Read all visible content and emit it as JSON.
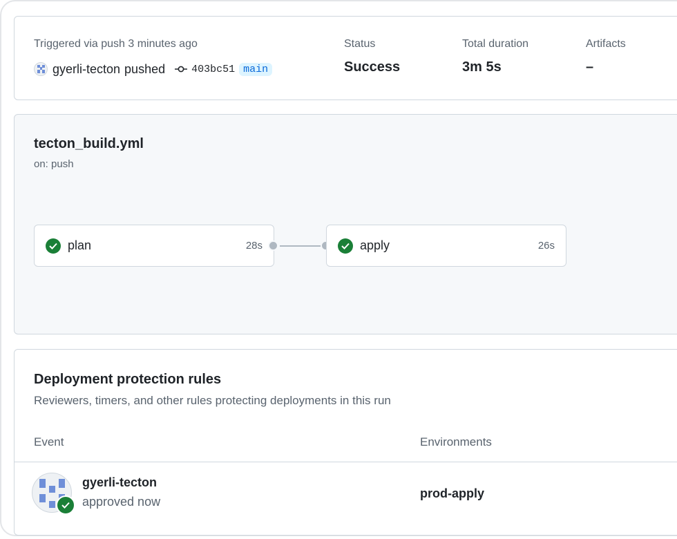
{
  "summary": {
    "trigger_text": "Triggered via push 3 minutes ago",
    "actor": "gyerli-tecton",
    "action": "pushed",
    "commit_sha": "403bc51",
    "branch": "main",
    "status_label": "Status",
    "status_value": "Success",
    "duration_label": "Total duration",
    "duration_value": "3m 5s",
    "artifacts_label": "Artifacts",
    "artifacts_value": "–"
  },
  "workflow": {
    "file": "tecton_build.yml",
    "trigger": "on: push",
    "jobs": [
      {
        "name": "plan",
        "duration": "28s",
        "status": "success"
      },
      {
        "name": "apply",
        "duration": "26s",
        "status": "success"
      }
    ]
  },
  "rules": {
    "title": "Deployment protection rules",
    "description": "Reviewers, timers, and other rules protecting deployments in this run",
    "columns": {
      "event": "Event",
      "environments": "Environments"
    },
    "rows": [
      {
        "reviewer": "gyerli-tecton",
        "state": "approved now",
        "environment": "prod-apply"
      }
    ]
  },
  "colors": {
    "success": "#1a7f37",
    "branch_text": "#0969da",
    "branch_bg": "#ddf4ff",
    "muted": "#59636e",
    "border": "#d0d7de",
    "panel_bg": "#f6f8fa"
  },
  "icons": [
    "commit-icon",
    "check-circle-icon",
    "avatar-identicon"
  ]
}
